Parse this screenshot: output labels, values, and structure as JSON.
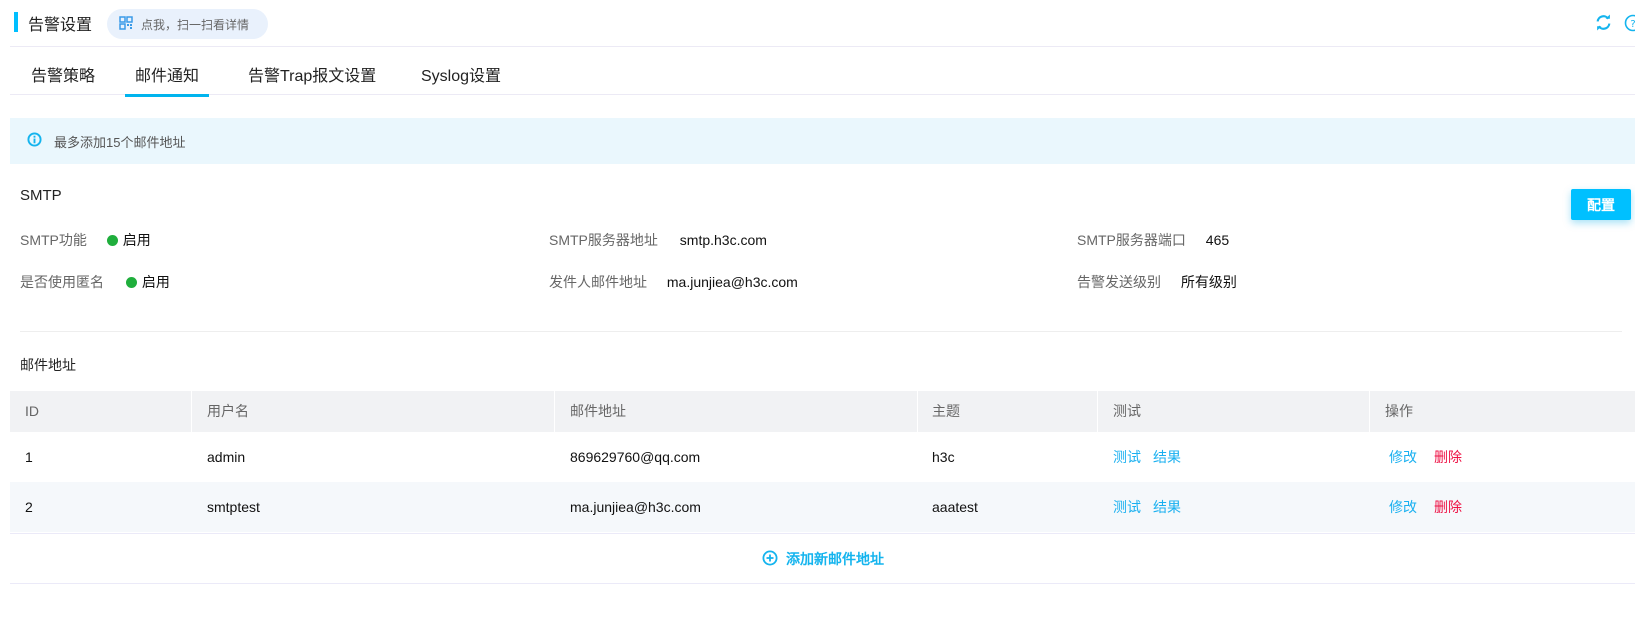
{
  "header": {
    "title": "告警设置",
    "qr_hint": "点我，扫一扫看详情"
  },
  "tabs": [
    {
      "label": "告警策略"
    },
    {
      "label": "邮件通知",
      "active": true
    },
    {
      "label": "告警Trap报文设置"
    },
    {
      "label": "Syslog设置"
    }
  ],
  "banner": {
    "text": "最多添加15个邮件地址"
  },
  "smtp": {
    "title": "SMTP",
    "config_button": "配置",
    "fields": {
      "function": {
        "label": "SMTP功能",
        "value": "启用"
      },
      "server": {
        "label": "SMTP服务器地址",
        "value": "smtp.h3c.com"
      },
      "port": {
        "label": "SMTP服务器端口",
        "value": "465"
      },
      "anonymous": {
        "label": "是否使用匿名",
        "value": "启用"
      },
      "sender": {
        "label": "发件人邮件地址",
        "value": "ma.junjiea@h3c.com"
      },
      "level": {
        "label": "告警发送级别",
        "value": "所有级别"
      }
    }
  },
  "emails": {
    "title": "邮件地址",
    "columns": [
      "ID",
      "用户名",
      "邮件地址",
      "主题",
      "测试",
      "操作"
    ],
    "rows": [
      {
        "id": "1",
        "username": "admin",
        "email": "869629760@qq.com",
        "subject": "h3c",
        "test": "测试",
        "result": "结果",
        "edit": "修改",
        "delete": "删除"
      },
      {
        "id": "2",
        "username": "smtptest",
        "email": "ma.junjiea@h3c.com",
        "subject": "aaatest",
        "test": "测试",
        "result": "结果",
        "edit": "修改",
        "delete": "删除"
      }
    ],
    "add_label": "添加新邮件地址"
  },
  "colors": {
    "accent": "#00c0ff",
    "enabled": "#1fae3c",
    "danger": "#ee1144"
  }
}
